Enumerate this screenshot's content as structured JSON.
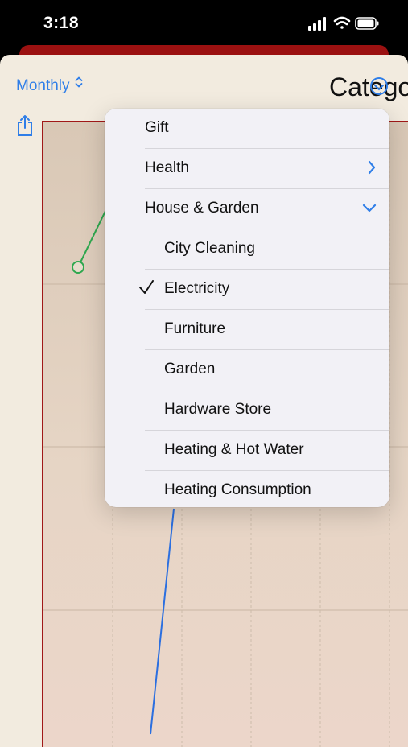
{
  "status": {
    "time": "3:18"
  },
  "toolbar": {
    "period_label": "Monthly",
    "title_partial": "Catego"
  },
  "menu": {
    "items": [
      {
        "label": "Gift",
        "level": 0,
        "chevron": "",
        "checked": false
      },
      {
        "label": "Health",
        "level": 0,
        "chevron": "right",
        "checked": false
      },
      {
        "label": "House & Garden",
        "level": 0,
        "chevron": "down",
        "checked": false
      },
      {
        "label": "City Cleaning",
        "level": 1,
        "chevron": "",
        "checked": false
      },
      {
        "label": "Electricity",
        "level": 1,
        "chevron": "",
        "checked": true
      },
      {
        "label": "Furniture",
        "level": 1,
        "chevron": "",
        "checked": false
      },
      {
        "label": "Garden",
        "level": 1,
        "chevron": "",
        "checked": false
      },
      {
        "label": "Hardware Store",
        "level": 1,
        "chevron": "",
        "checked": false
      },
      {
        "label": "Heating & Hot Water",
        "level": 1,
        "chevron": "",
        "checked": false
      },
      {
        "label": "Heating Consumption",
        "level": 1,
        "chevron": "",
        "checked": false
      }
    ]
  },
  "colors": {
    "accent": "#2f7ee8",
    "chart_border": "#a01818",
    "green_series": "#2fa84f",
    "blue_series": "#2b6fe0"
  }
}
